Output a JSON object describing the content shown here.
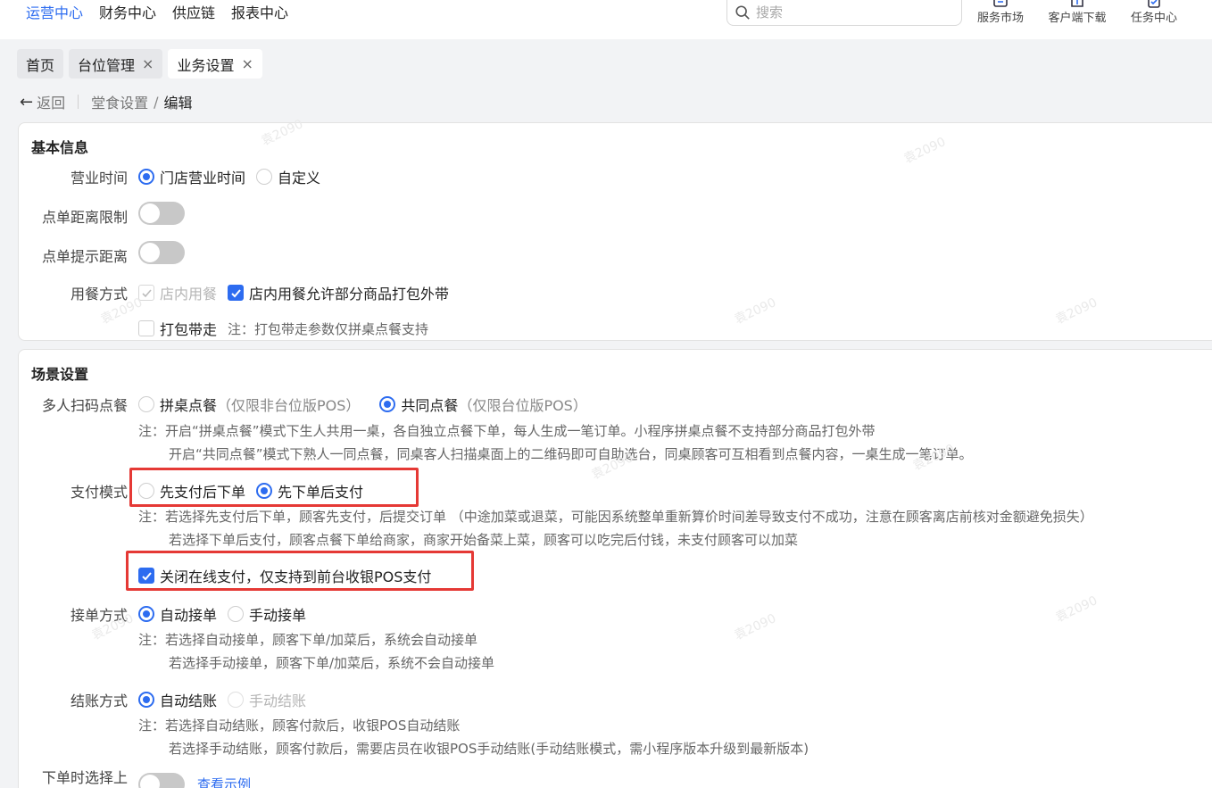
{
  "topnav": [
    "运营中心",
    "财务中心",
    "供应链",
    "报表中心"
  ],
  "search": {
    "placeholder": "搜索"
  },
  "tools": [
    "服务市场",
    "客户端下载",
    "任务中心"
  ],
  "tabs": [
    {
      "label": "首页",
      "closable": false
    },
    {
      "label": "台位管理",
      "closable": true
    },
    {
      "label": "业务设置",
      "closable": true,
      "active": true
    }
  ],
  "tab_close": "×",
  "breadcrumb": {
    "back": "返回",
    "parent": "堂食设置",
    "separator": "/",
    "current": "编辑"
  },
  "basic": {
    "title": "基本信息",
    "hours_label": "营业时间",
    "hours_options": [
      "门店营业时间",
      "自定义"
    ],
    "distance_limit_label": "点单距离限制",
    "distance_hint_label": "点单提示距离",
    "dining_label": "用餐方式",
    "dining_dine_in": "店内用餐",
    "dining_allow_takeaway": "店内用餐允许部分商品打包外带",
    "dining_takeaway": "打包带走",
    "dining_takeaway_note": "注：打包带走参数仅拼桌点餐支持"
  },
  "scene": {
    "title": "场景设置",
    "multi_label": "多人扫码点餐",
    "multi_opt1": "拼桌点餐",
    "multi_opt1_hint": "（仅限非台位版POS）",
    "multi_opt2": "共同点餐",
    "multi_opt2_hint": "（仅限台位版POS）",
    "multi_note1": "注：开启“拼桌点餐”模式下生人共用一桌，各自独立点餐下单，每人生成一笔订单。小程序拼桌点餐不支持部分商品打包外带",
    "multi_note2": "开启“共同点餐”模式下熟人一同点餐，同桌客人扫描桌面上的二维码即可自助选台，同桌顾客可互相看到点餐内容，一桌生成一笔订单。",
    "pay_label": "支付模式",
    "pay_opt1": "先支付后下单",
    "pay_opt2": "先下单后支付",
    "pay_note1": "注：若选择先支付后下单，顾客先支付，后提交订单 （中途加菜或退菜，可能因系统整单重新算价时间差导致支付不成功，注意在顾客离店前核对金额避免损失）",
    "pay_note2": "若选择下单后支付，顾客点餐下单给商家，商家开始备菜上菜，顾客可以吃完后付钱，未支付顾客可以加菜",
    "close_online_pay": "关闭在线支付，仅支持到前台收银POS支付",
    "accept_label": "接单方式",
    "accept_opt1": "自动接单",
    "accept_opt2": "手动接单",
    "accept_note1": "注：若选择自动接单，顾客下单/加菜后，系统会自动接单",
    "accept_note2": "若选择手动接单，顾客下单/加菜后，系统不会自动接单",
    "settle_label": "结账方式",
    "settle_opt1": "自动结账",
    "settle_opt2": "手动结账",
    "settle_note1": "注：若选择自动结账，顾客付款后，收银POS自动结账",
    "settle_note2": "若选择手动结账，顾客付款后，需要店员在收银POS手动结账(手动结账模式，需小程序版本升级到最新版本)",
    "order_select_label": "下单时选择上",
    "view_example": "查看示例"
  },
  "colors": {
    "accent": "#2d6cf0",
    "highlight": "#e53935"
  },
  "watermark": "袁2090"
}
